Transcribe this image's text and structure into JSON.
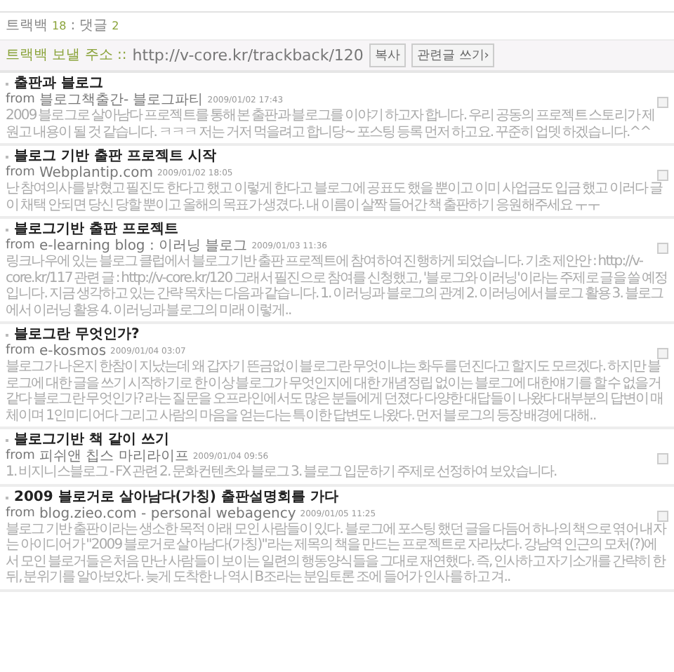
{
  "counts": {
    "trackback_label": "트랙백",
    "trackback_count": "18",
    "separator": ":",
    "comment_label": "댓글",
    "comment_count": "2"
  },
  "address": {
    "label": "트랙백 보낼 주소 ::",
    "url": "http://v-core.kr/trackback/120",
    "buttons": [
      "복사",
      "관련글 쓰기›"
    ]
  },
  "entries": [
    {
      "title": "출판과 블로그",
      "from": "from",
      "source": "블로그책출간- 블로그파티",
      "date": "2009/01/02 17:43",
      "body": "2009 블로그로 살아남다 프로젝트를 통해 본 출판과 블로그를 이야기 하고자 합니다. 우리 공동의 프로젝트 스토리가 제 원고 내용이 될 것 같습니다. ㅋㅋㅋ 저는 거저 먹을려고 합니당~ 포스팅 등록 먼저 하고요. 꾸준히 업뎃 하겠습니다.^^"
    },
    {
      "title": "블로그 기반 출판 프로젝트 시작",
      "from": "from",
      "source": "Webplantip.com",
      "date": "2009/01/02 18:05",
      "body": "난 참여의사를 밝혔고 필진도 한다고 했고 이렇게 한다고 블로그에 공표도 했을 뿐이고 이미 사업금도 입금 했고 이러다 글이 채택 안되면 당신 당할 뿐이고 올해의 목표가 생겼다. 내 이름이 살짝 들어간 책 출판하기 응원해주세요 ㅜㅜ"
    },
    {
      "title": "블로그기반 출판 프로젝트",
      "from": "from",
      "source": "e-learning blog : 이러닝 블로그",
      "date": "2009/01/03 11:36",
      "body": "링크나우에 있는 블로그 클럽에서 블로그기반 출판 프로젝트에 참여하여 진행하게 되었습니다. 기초 제안안 : http://v-core.kr/117 관련 글 : http://v-core.kr/120 그래서 필진으로 참여를 신청했고, '블로그와 이러닝'이라는 주제로 글을 쓸 예정입니다. 지금 생각하고 있는 간략 목차는 다음과 같습니다. 1. 이러닝과 블로그의 관계 2. 이러닝에서 블로그 활용 3. 블로그에서 이러닝 활용 4. 이러닝과 블로그의 미래 이렇게.."
    },
    {
      "title": "블로그란 무엇인가?",
      "from": "from",
      "source": "e-kosmos",
      "date": "2009/01/04 03:07",
      "body": "블로그가 나온지 한참이 지났는데 왜 갑자기 뜬금없이 블로그란 무엇이냐는 화두를 던진다고 할지도 모르겠다. 하지만 블로그에 대한 글을 쓰기 시작하기로 한 이상 블로그가 무엇인지에 대한 개념정립 없이는 블로그에 대한얘기를 할 수 없을거 같다 블로그란 무엇인가? 라는 질문을 오프라인에서도 많은 분들에게 던졌다 다양한 대답들이 나왔다 대부분의 답변이 매체이며 1인미디어다 그리고 사람의 마음을 얻는다는 특이한 답변도 나왔다. 먼저 블로그의 등장 배경에 대해.."
    },
    {
      "title": "블로그기반 책 같이 쓰기",
      "from": "from",
      "source": "피쉬앤 칩스 마리라이프",
      "date": "2009/01/04 09:56",
      "body": "1. 비지니스블로그 - FX 관련 2. 문화컨텐츠와 블로그 3. 블로그 입문하기 주제로 선정하여 보았습니다."
    },
    {
      "title": "2009 블로거로 살아남다(가칭) 출판설명회를 가다",
      "from": "from",
      "source": "blog.zieo.com - personal webagency",
      "date": "2009/01/05 11:25",
      "body": "블로그 기반 출판이라는 생소한 목적 아래 모인 사람들이 있다. 블로그에 포스팅 했던 글을 다듬어 하나의 책으로 엮어 내자는 아이디어가 \"2009 블로거로 살아남다(가칭)\"라는 제목의 책을 만드는 프로젝트로 자라났다. 강남역 인근의 모처(?)에서 모인 블로거들은 처음 만난 사람들이 보이는 일련의 행동양식들을 그대로 재연했다. 즉, 인사하고 자기소개를 간략히 한 뒤, 분위기를 알아보았다. 늦게 도착한 나 역시 B조라는 분임토론 조에 들어가 인사를 하고 겨.."
    }
  ]
}
